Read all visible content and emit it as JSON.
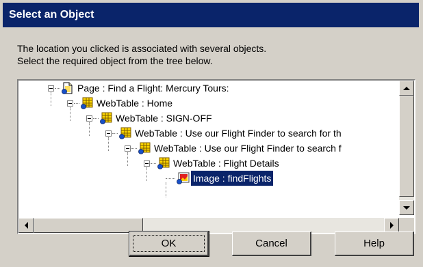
{
  "window": {
    "title": "Select an Object"
  },
  "instructions": {
    "line1": "The location you clicked is associated with several objects.",
    "line2": "Select the required object from the tree below."
  },
  "tree": {
    "nodes": [
      {
        "label": "Page : Find a Flight: Mercury Tours:",
        "icon": "page-icon",
        "expanded": true
      },
      {
        "label": "WebTable : Home",
        "icon": "webtable-icon",
        "expanded": true
      },
      {
        "label": "WebTable : SIGN-OFF",
        "icon": "webtable-icon",
        "expanded": true
      },
      {
        "label": "WebTable : Use our Flight Finder to search for th",
        "icon": "webtable-icon",
        "expanded": true
      },
      {
        "label": "WebTable : Use our Flight Finder to search f",
        "icon": "webtable-icon",
        "expanded": true
      },
      {
        "label": "WebTable :   Flight Details",
        "icon": "webtable-icon",
        "expanded": true
      },
      {
        "label": "Image : findFlights",
        "icon": "image-icon",
        "selected": true
      }
    ]
  },
  "buttons": {
    "ok": "OK",
    "cancel": "Cancel",
    "help": "Help"
  },
  "colors": {
    "titlebar": "#0a246a",
    "selection": "#0a246a",
    "face": "#d4d0c8"
  }
}
